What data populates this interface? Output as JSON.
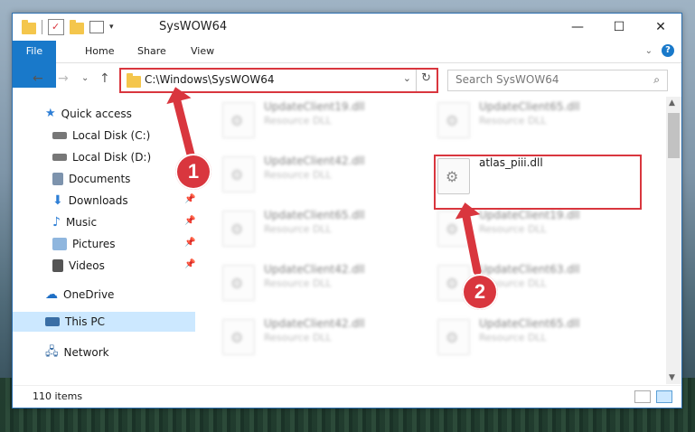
{
  "window": {
    "title": "SysWOW64",
    "minimize_glyph": "—",
    "maximize_glyph": "☐",
    "close_glyph": "✕"
  },
  "ribbon": {
    "tabs": [
      "File",
      "Home",
      "Share",
      "View"
    ]
  },
  "address": {
    "path": "C:\\Windows\\SysWOW64"
  },
  "search": {
    "placeholder": "Search SysWOW64"
  },
  "sidebar": {
    "items": [
      {
        "label": "Quick access",
        "icon": "star-icon",
        "color": "#2e7fd6"
      },
      {
        "label": "Local Disk (C:)",
        "icon": "drive-icon",
        "color": "#666666"
      },
      {
        "label": "Local Disk (D:)",
        "icon": "drive-icon",
        "color": "#666666"
      },
      {
        "label": "Documents",
        "icon": "documents-icon",
        "color": "#6a7f9a"
      },
      {
        "label": "Downloads",
        "icon": "download-icon",
        "color": "#2e7fd6"
      },
      {
        "label": "Music",
        "icon": "music-icon",
        "color": "#2e7fd6"
      },
      {
        "label": "Pictures",
        "icon": "pictures-icon",
        "color": "#6a9fd6"
      },
      {
        "label": "Videos",
        "icon": "videos-icon",
        "color": "#555555"
      },
      {
        "label": "OneDrive",
        "icon": "cloud-icon",
        "color": "#1f6fc5"
      },
      {
        "label": "This PC",
        "icon": "computer-icon",
        "color": "#3a6ea5"
      },
      {
        "label": "Network",
        "icon": "network-icon",
        "color": "#3a6ea5"
      }
    ]
  },
  "files": [
    {
      "name": "UpdateClient19.dll",
      "type": "Resource DLL"
    },
    {
      "name": "UpdateClient65.dll",
      "type": "Resource DLL"
    },
    {
      "name": "UpdateClient42.dll",
      "type": "Resource DLL"
    },
    {
      "name": "atlas_piii.dll",
      "type": ""
    },
    {
      "name": "UpdateClient65.dll",
      "type": "Resource DLL"
    },
    {
      "name": "UpdateClient19.dll",
      "type": "Resource DLL"
    },
    {
      "name": "UpdateClient42.dll",
      "type": "Resource DLL"
    },
    {
      "name": "UpdateClient63.dll",
      "type": "Resource DLL"
    },
    {
      "name": "UpdateClient42.dll",
      "type": "Resource DLL"
    },
    {
      "name": "UpdateClient65.dll",
      "type": "Resource DLL"
    }
  ],
  "status": {
    "item_count": "110 items"
  },
  "callouts": [
    "1",
    "2"
  ],
  "colors": {
    "accent": "#1979ca",
    "highlight": "#d9363e",
    "selected_nav": "#cce8ff"
  }
}
